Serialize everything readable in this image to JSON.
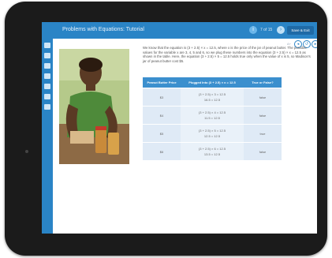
{
  "header": {
    "title": "Problems with Equations: Tutorial",
    "info_icon": "i",
    "progress": "7 of 15",
    "next_icon": "›",
    "save_label": "Save & Exit"
  },
  "sidebar": {
    "icons": [
      "menu-icon",
      "edit-icon",
      "folder-icon",
      "book-icon",
      "lightbulb-icon",
      "video-icon",
      "tools-icon"
    ]
  },
  "controls": {
    "label": "A+",
    "prev_icon": "◂",
    "replay_icon": "↺",
    "next_icon": "▸"
  },
  "content": {
    "paragraph": "We know that the equation is (3 + 2.5) × x = 12.5, where x is the price of the jar of peanut butter. The possible values for the variable x are 3, 4, 5 and 6, so we plug these numbers into the equation (3 + 2.5) × x = 12.5 as shown in the table. Here, the equation (3 + 2.5) × 5 = 12.5 holds true only when the value of x is 5, so Madison's jar of peanut butter cost $5.",
    "table": {
      "headers": [
        "Peanut Butter Price",
        "Plugged Into (3 + 2.5) × x = 12.5",
        "True or False?"
      ],
      "rows": [
        {
          "price": "$3",
          "line1": "(3 + 2.5) × 3 = 12.5",
          "line2": "16.5 = 12.5",
          "result": "false"
        },
        {
          "price": "$4",
          "line1": "(3 + 2.5) × 4 = 12.5",
          "line2": "11.5 = 12.5",
          "result": "false"
        },
        {
          "price": "$5",
          "line1": "(3 + 2.5) × 5 = 12.5",
          "line2": "12.5 = 12.5",
          "result": "true"
        },
        {
          "price": "$6",
          "line1": "(3 + 2.5) × 6 = 12.5",
          "line2": "13.5 = 12.5",
          "result": "false"
        }
      ]
    }
  },
  "colors": {
    "accent": "#2a84c6",
    "bezel": "#1b1b1b",
    "table_header": "#3b8fce",
    "table_row": "#dfeaf6"
  }
}
